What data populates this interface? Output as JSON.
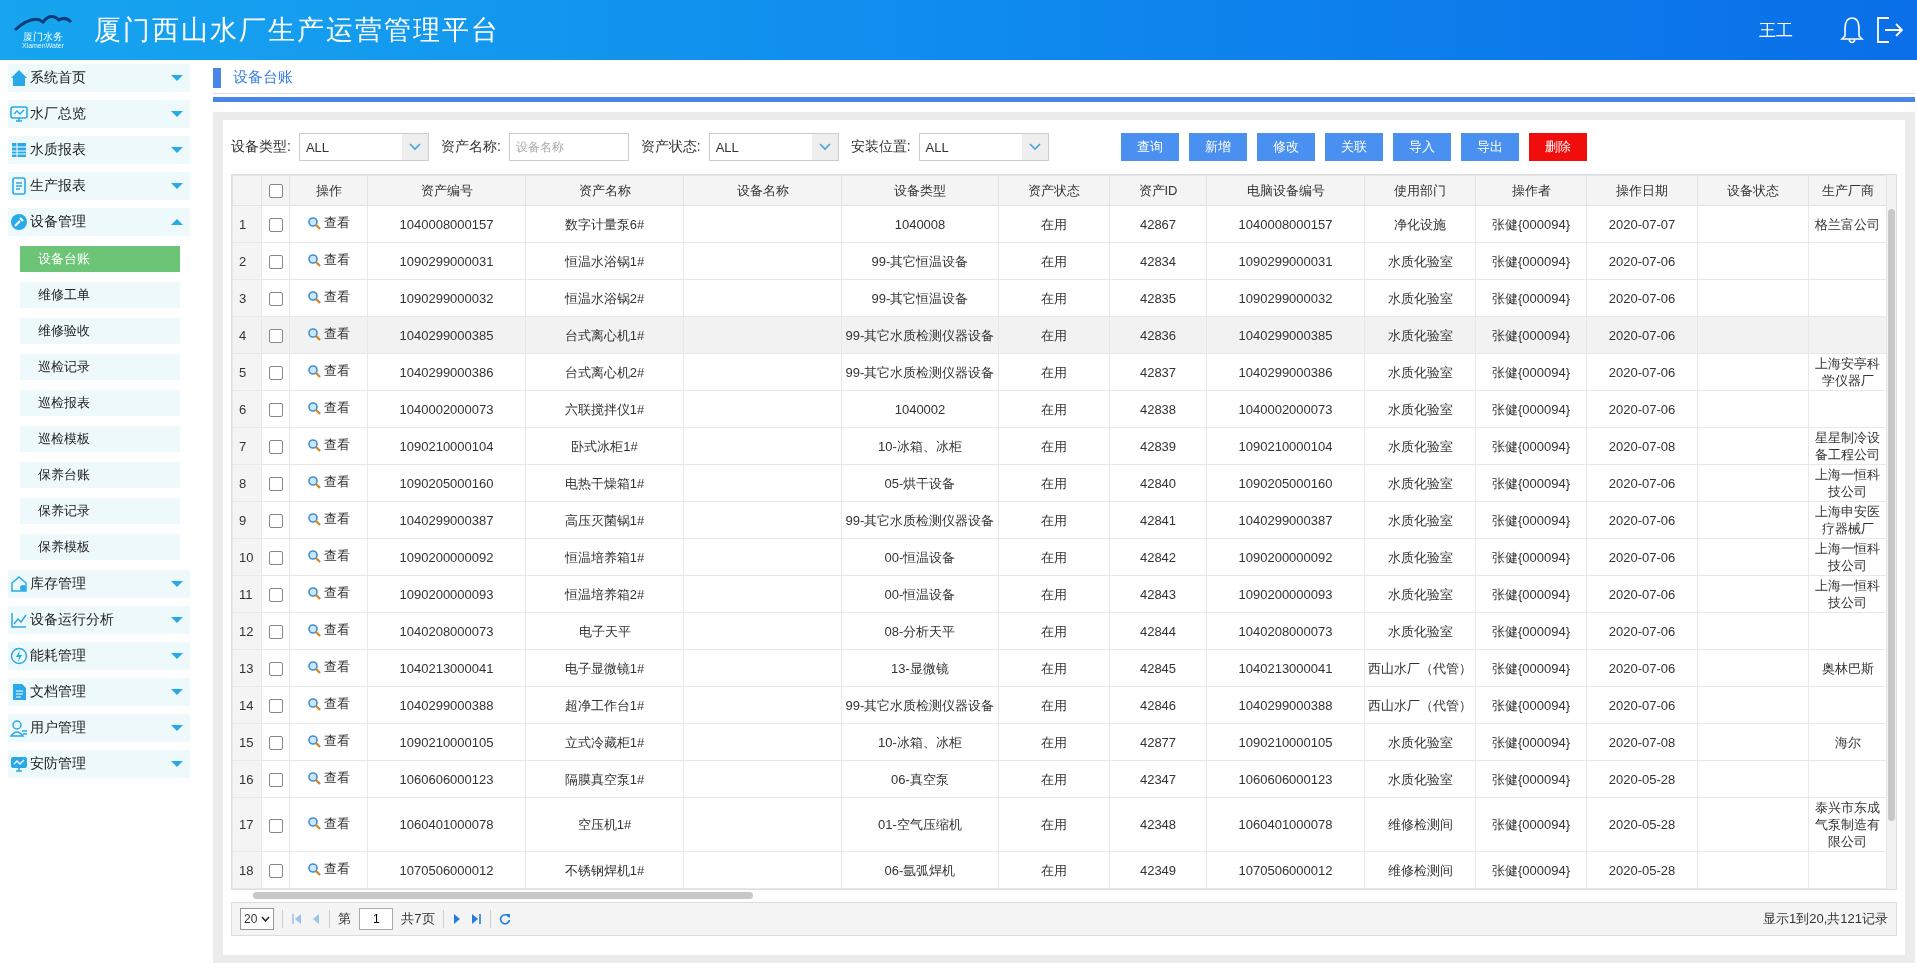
{
  "header": {
    "logo_text": "厦门水务",
    "logo_subtext": "XiamenWater",
    "title": "厦门西山水厂生产运营管理平台",
    "user": "王工"
  },
  "sidebar": {
    "items": [
      {
        "label": "系统首页",
        "expanded": false
      },
      {
        "label": "水厂总览",
        "expanded": false
      },
      {
        "label": "水质报表",
        "expanded": false
      },
      {
        "label": "生产报表",
        "expanded": false
      },
      {
        "label": "设备管理",
        "expanded": true,
        "children": [
          {
            "label": "设备台账",
            "selected": true
          },
          {
            "label": "维修工单",
            "selected": false
          },
          {
            "label": "维修验收",
            "selected": false
          },
          {
            "label": "巡检记录",
            "selected": false
          },
          {
            "label": "巡检报表",
            "selected": false
          },
          {
            "label": "巡检模板",
            "selected": false
          },
          {
            "label": "保养台账",
            "selected": false
          },
          {
            "label": "保养记录",
            "selected": false
          },
          {
            "label": "保养模板",
            "selected": false
          }
        ]
      },
      {
        "label": "库存管理",
        "expanded": false
      },
      {
        "label": "设备运行分析",
        "expanded": false
      },
      {
        "label": "能耗管理",
        "expanded": false
      },
      {
        "label": "文档管理",
        "expanded": false
      },
      {
        "label": "用户管理",
        "expanded": false
      },
      {
        "label": "安防管理",
        "expanded": false
      }
    ]
  },
  "breadcrumb": "设备台账",
  "filters": [
    {
      "label": "设备类型:",
      "kind": "select",
      "value": "ALL"
    },
    {
      "label": "资产名称:",
      "kind": "input",
      "placeholder": "设备名称"
    },
    {
      "label": "资产状态:",
      "kind": "select",
      "value": "ALL"
    },
    {
      "label": "安装位置:",
      "kind": "select",
      "value": "ALL"
    }
  ],
  "buttons": [
    {
      "label": "查询",
      "kind": "primary"
    },
    {
      "label": "新增",
      "kind": "primary"
    },
    {
      "label": "修改",
      "kind": "primary"
    },
    {
      "label": "关联",
      "kind": "primary"
    },
    {
      "label": "导入",
      "kind": "primary"
    },
    {
      "label": "导出",
      "kind": "primary"
    },
    {
      "label": "删除",
      "kind": "danger"
    }
  ],
  "table": {
    "all_checked": false,
    "columns": [
      "操作",
      "资产编号",
      "资产名称",
      "设备名称",
      "设备类型",
      "资产状态",
      "资产ID",
      "电脑设备编号",
      "使用部门",
      "操作者",
      "操作日期",
      "设备状态",
      "生产厂商"
    ],
    "rows": [
      {
        "number": "1",
        "checked": false,
        "highlighted": false,
        "cells": [
          "查看",
          "1040008000157",
          "数字计量泵6#",
          null,
          "1040008",
          "在用",
          "42867",
          "1040008000157",
          "净化设施",
          "张健{000094}",
          "2020-07-07",
          null,
          "格兰富公司"
        ]
      },
      {
        "number": "2",
        "checked": false,
        "highlighted": false,
        "cells": [
          "查看",
          "1090299000031",
          "恒温水浴锅1#",
          null,
          "99-其它恒温设备",
          "在用",
          "42834",
          "1090299000031",
          "水质化验室",
          "张健{000094}",
          "2020-07-06",
          null,
          null
        ]
      },
      {
        "number": "3",
        "checked": false,
        "highlighted": false,
        "cells": [
          "查看",
          "1090299000032",
          "恒温水浴锅2#",
          null,
          "99-其它恒温设备",
          "在用",
          "42835",
          "1090299000032",
          "水质化验室",
          "张健{000094}",
          "2020-07-06",
          null,
          null
        ]
      },
      {
        "number": "4",
        "checked": false,
        "highlighted": true,
        "cells": [
          "查看",
          "1040299000385",
          "台式离心机1#",
          null,
          "99-其它水质检测仪器设备",
          "在用",
          "42836",
          "1040299000385",
          "水质化验室",
          "张健{000094}",
          "2020-07-06",
          null,
          null
        ]
      },
      {
        "number": "5",
        "checked": false,
        "highlighted": false,
        "cells": [
          "查看",
          "1040299000386",
          "台式离心机2#",
          null,
          "99-其它水质检测仪器设备",
          "在用",
          "42837",
          "1040299000386",
          "水质化验室",
          "张健{000094}",
          "2020-07-06",
          null,
          "上海安亭科学仪器厂"
        ]
      },
      {
        "number": "6",
        "checked": false,
        "highlighted": false,
        "cells": [
          "查看",
          "1040002000073",
          "六联搅拌仪1#",
          null,
          "1040002",
          "在用",
          "42838",
          "1040002000073",
          "水质化验室",
          "张健{000094}",
          "2020-07-06",
          null,
          null
        ]
      },
      {
        "number": "7",
        "checked": false,
        "highlighted": false,
        "cells": [
          "查看",
          "1090210000104",
          "卧式冰柜1#",
          null,
          "10-冰箱、冰柜",
          "在用",
          "42839",
          "1090210000104",
          "水质化验室",
          "张健{000094}",
          "2020-07-08",
          null,
          "星星制冷设备工程公司"
        ]
      },
      {
        "number": "8",
        "checked": false,
        "highlighted": false,
        "cells": [
          "查看",
          "1090205000160",
          "电热干燥箱1#",
          null,
          "05-烘干设备",
          "在用",
          "42840",
          "1090205000160",
          "水质化验室",
          "张健{000094}",
          "2020-07-06",
          null,
          "上海一恒科技公司"
        ]
      },
      {
        "number": "9",
        "checked": false,
        "highlighted": false,
        "cells": [
          "查看",
          "1040299000387",
          "高压灭菌锅1#",
          null,
          "99-其它水质检测仪器设备",
          "在用",
          "42841",
          "1040299000387",
          "水质化验室",
          "张健{000094}",
          "2020-07-06",
          null,
          "上海申安医疗器械厂"
        ]
      },
      {
        "number": "10",
        "checked": false,
        "highlighted": false,
        "cells": [
          "查看",
          "1090200000092",
          "恒温培养箱1#",
          null,
          "00-恒温设备",
          "在用",
          "42842",
          "1090200000092",
          "水质化验室",
          "张健{000094}",
          "2020-07-06",
          null,
          "上海一恒科技公司"
        ]
      },
      {
        "number": "11",
        "checked": false,
        "highlighted": false,
        "cells": [
          "查看",
          "1090200000093",
          "恒温培养箱2#",
          null,
          "00-恒温设备",
          "在用",
          "42843",
          "1090200000093",
          "水质化验室",
          "张健{000094}",
          "2020-07-06",
          null,
          "上海一恒科技公司"
        ]
      },
      {
        "number": "12",
        "checked": false,
        "highlighted": false,
        "cells": [
          "查看",
          "1040208000073",
          "电子天平",
          null,
          "08-分析天平",
          "在用",
          "42844",
          "1040208000073",
          "水质化验室",
          "张健{000094}",
          "2020-07-06",
          null,
          null
        ]
      },
      {
        "number": "13",
        "checked": false,
        "highlighted": false,
        "cells": [
          "查看",
          "1040213000041",
          "电子显微镜1#",
          null,
          "13-显微镜",
          "在用",
          "42845",
          "1040213000041",
          "西山水厂（代管）",
          "张健{000094}",
          "2020-07-06",
          null,
          "奥林巴斯"
        ]
      },
      {
        "number": "14",
        "checked": false,
        "highlighted": false,
        "cells": [
          "查看",
          "1040299000388",
          "超净工作台1#",
          null,
          "99-其它水质检测仪器设备",
          "在用",
          "42846",
          "1040299000388",
          "西山水厂（代管）",
          "张健{000094}",
          "2020-07-06",
          null,
          null
        ]
      },
      {
        "number": "15",
        "checked": false,
        "highlighted": false,
        "cells": [
          "查看",
          "1090210000105",
          "立式冷藏柜1#",
          null,
          "10-冰箱、冰柜",
          "在用",
          "42877",
          "1090210000105",
          "水质化验室",
          "张健{000094}",
          "2020-07-08",
          null,
          "海尔"
        ]
      },
      {
        "number": "16",
        "checked": false,
        "highlighted": false,
        "cells": [
          "查看",
          "1060606000123",
          "隔膜真空泵1#",
          null,
          "06-真空泵",
          "在用",
          "42347",
          "1060606000123",
          "水质化验室",
          "张健{000094}",
          "2020-05-28",
          null,
          null
        ]
      },
      {
        "number": "17",
        "checked": false,
        "highlighted": false,
        "cells": [
          "查看",
          "1060401000078",
          "空压机1#",
          null,
          "01-空气压缩机",
          "在用",
          "42348",
          "1060401000078",
          "维修检测间",
          "张健{000094}",
          "2020-05-28",
          null,
          "泰兴市东成气泵制造有限公司"
        ]
      },
      {
        "number": "18",
        "checked": false,
        "highlighted": false,
        "cells": [
          "查看",
          "1070506000012",
          "不锈钢焊机1#",
          null,
          "06-氩弧焊机",
          "在用",
          "42349",
          "1070506000012",
          "维修检测间",
          "张健{000094}",
          "2020-05-28",
          null,
          null
        ]
      }
    ]
  },
  "pager": {
    "page_size": "20",
    "page_before": "第",
    "page": "1",
    "page_after": "共7页",
    "summary": "显示1到20,共121记录"
  }
}
